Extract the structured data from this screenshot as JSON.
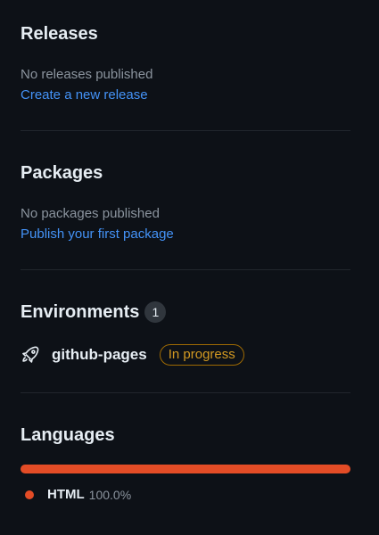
{
  "releases": {
    "title": "Releases",
    "empty_text": "No releases published",
    "create_link": "Create a new release"
  },
  "packages": {
    "title": "Packages",
    "empty_text": "No packages published",
    "publish_link": "Publish your first package"
  },
  "environments": {
    "title": "Environments",
    "count": "1",
    "items": [
      {
        "icon": "rocket-icon",
        "name": "github-pages",
        "status": "In progress",
        "status_color": "#d29922"
      }
    ]
  },
  "languages": {
    "title": "Languages",
    "items": [
      {
        "name": "HTML",
        "percent": "100.0%",
        "share": 1.0,
        "color": "#e34c26"
      }
    ]
  }
}
